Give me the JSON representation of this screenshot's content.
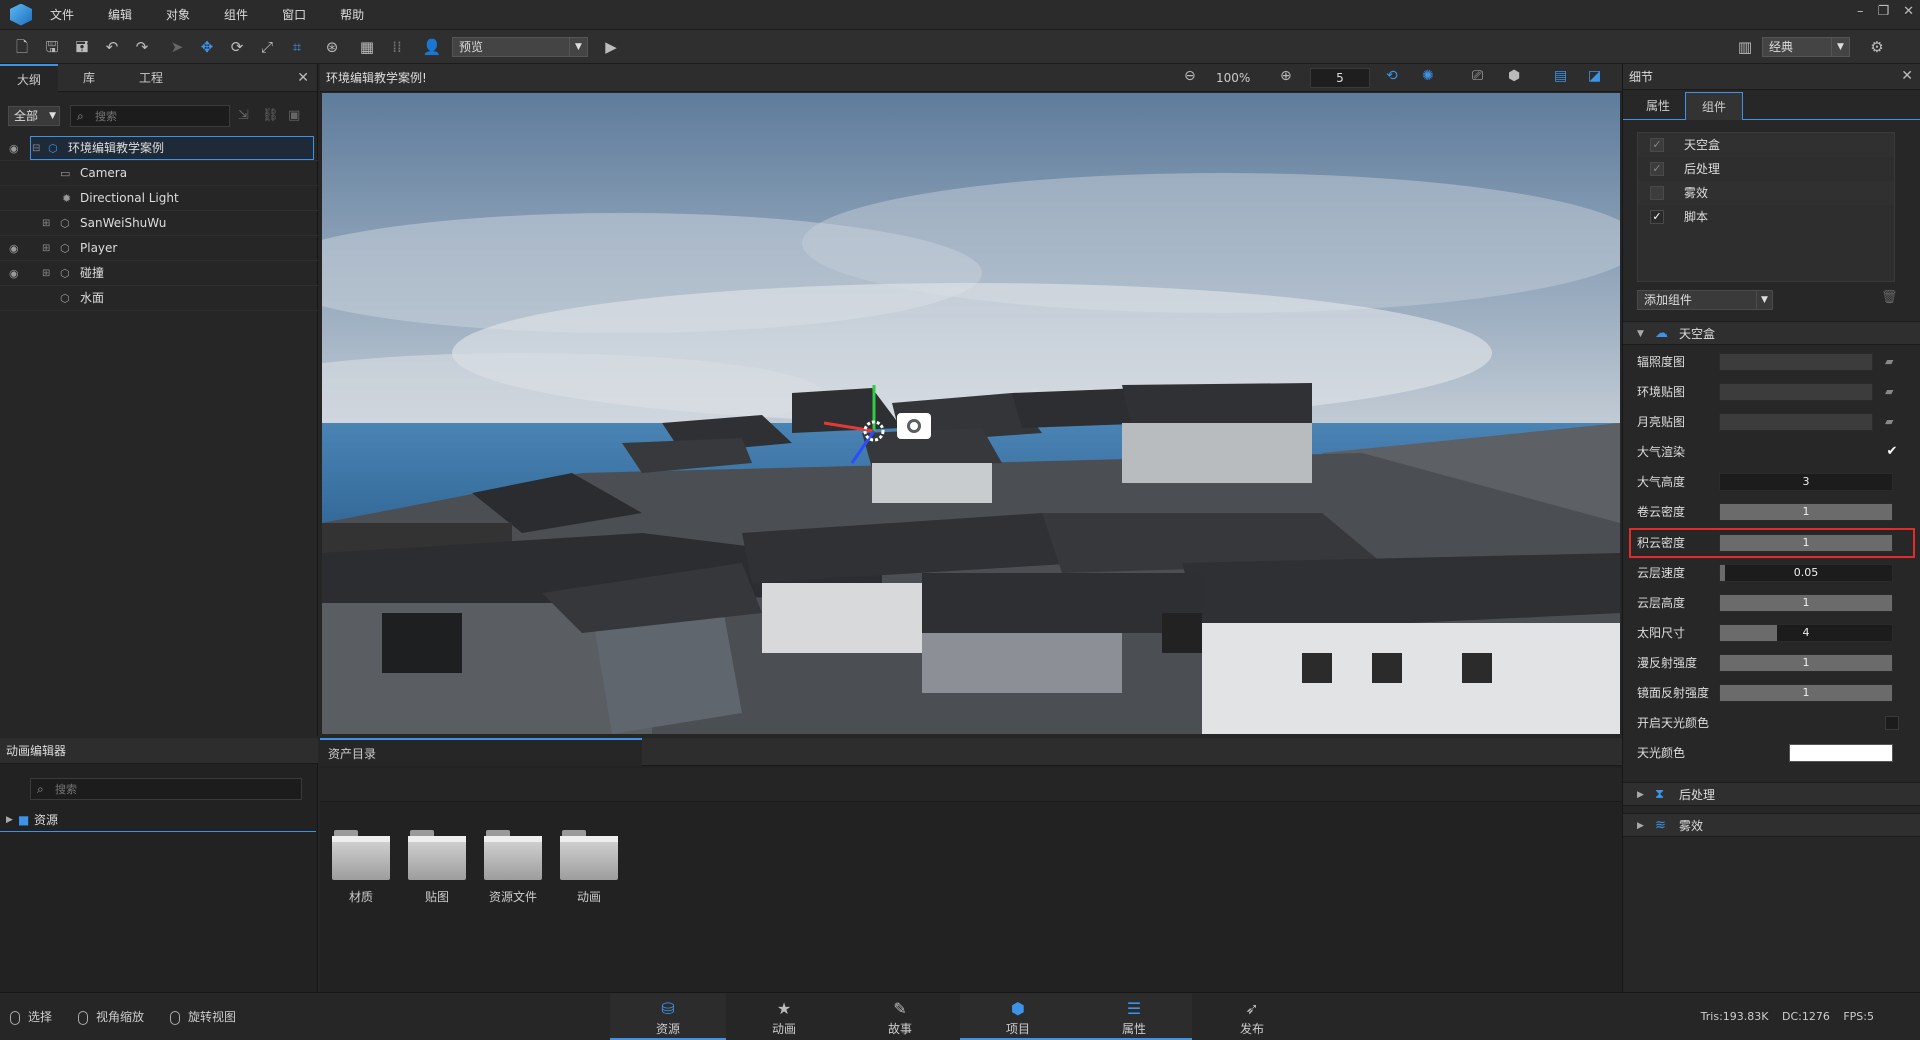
{
  "menu": [
    "文件",
    "编辑",
    "对象",
    "组件",
    "窗口",
    "帮助"
  ],
  "toolbar": {
    "preview_select": "预览",
    "layout_select": "经典"
  },
  "outline": {
    "tabs": [
      "大纲",
      "库",
      "工程"
    ],
    "filter": "全部",
    "search_placeholder": "搜索",
    "tree": [
      {
        "label": "环境编辑教学案例",
        "icon": "group-icon",
        "visible": true,
        "expandable": true
      },
      {
        "label": "Camera",
        "icon": "camera-icon",
        "visible": false,
        "expandable": false
      },
      {
        "label": "Directional Light",
        "icon": "light-icon",
        "visible": false,
        "expandable": false
      },
      {
        "label": "SanWeiShuWu",
        "icon": "group-icon",
        "visible": false,
        "expandable": true
      },
      {
        "label": "Player",
        "icon": "group-icon",
        "visible": true,
        "expandable": true
      },
      {
        "label": "碰撞",
        "icon": "group-icon",
        "visible": true,
        "expandable": true
      },
      {
        "label": "水面",
        "icon": "group-icon",
        "visible": false,
        "expandable": false
      }
    ]
  },
  "viewport": {
    "title": "环境编辑教学案例!",
    "zoom": "100%",
    "step": "5"
  },
  "details": {
    "title": "细节",
    "tabs": [
      "属性",
      "组件"
    ],
    "components": [
      {
        "label": "天空盒",
        "checked": true
      },
      {
        "label": "后处理",
        "checked": true
      },
      {
        "label": "雾效",
        "checked": false
      },
      {
        "label": "脚本",
        "checked": true
      }
    ],
    "add_component": "添加组件",
    "skybox_section": "天空盒",
    "props": {
      "irradiance": "辐照度图",
      "env_map": "环境贴图",
      "moon_map": "月亮贴图",
      "atmosphere": "大气渲染",
      "atmos_height": {
        "label": "大气高度",
        "value": "3",
        "fraction": 0.0
      },
      "cirrus": {
        "label": "卷云密度",
        "value": "1",
        "fraction": 1.0
      },
      "cumulus": {
        "label": "积云密度",
        "value": "1",
        "fraction": 1.0
      },
      "cloud_speed": {
        "label": "云层速度",
        "value": "0.05",
        "fraction": 0.03
      },
      "cloud_height": {
        "label": "云层高度",
        "value": "1",
        "fraction": 1.0
      },
      "sun_size": {
        "label": "太阳尺寸",
        "value": "4",
        "fraction": 0.33
      },
      "diffuse": {
        "label": "漫反射强度",
        "value": "1",
        "fraction": 1.0
      },
      "specular": {
        "label": "镜面反射强度",
        "value": "1",
        "fraction": 1.0
      },
      "skylight_enable": "开启天光颜色",
      "skylight_color": {
        "label": "天光颜色",
        "color": "#ffffff"
      }
    },
    "post_section": "后处理",
    "fog_section": "雾效"
  },
  "anim": {
    "title": "动画编辑器",
    "search_placeholder": "搜索",
    "root": "资源"
  },
  "assets": {
    "tab": "资产目录",
    "folders": [
      "材质",
      "贴图",
      "资源文件",
      "动画"
    ]
  },
  "status": {
    "modes": [
      "选择",
      "视角缩放",
      "旋转视图"
    ],
    "tabs": [
      {
        "label": "资源",
        "icon": "resource-icon",
        "active": true
      },
      {
        "label": "动画",
        "icon": "animation-icon",
        "active": false
      },
      {
        "label": "故事",
        "icon": "story-icon",
        "active": false
      },
      {
        "label": "项目",
        "icon": "project-icon",
        "active": true
      },
      {
        "label": "属性",
        "icon": "properties-icon",
        "active": true
      },
      {
        "label": "发布",
        "icon": "publish-icon",
        "active": false
      }
    ],
    "tris": "Tris:193.83K",
    "dc": "DC:1276",
    "fps": "FPS:5"
  },
  "colors": {
    "accent": "#3d93e8",
    "highlight": "#e22b2b"
  }
}
